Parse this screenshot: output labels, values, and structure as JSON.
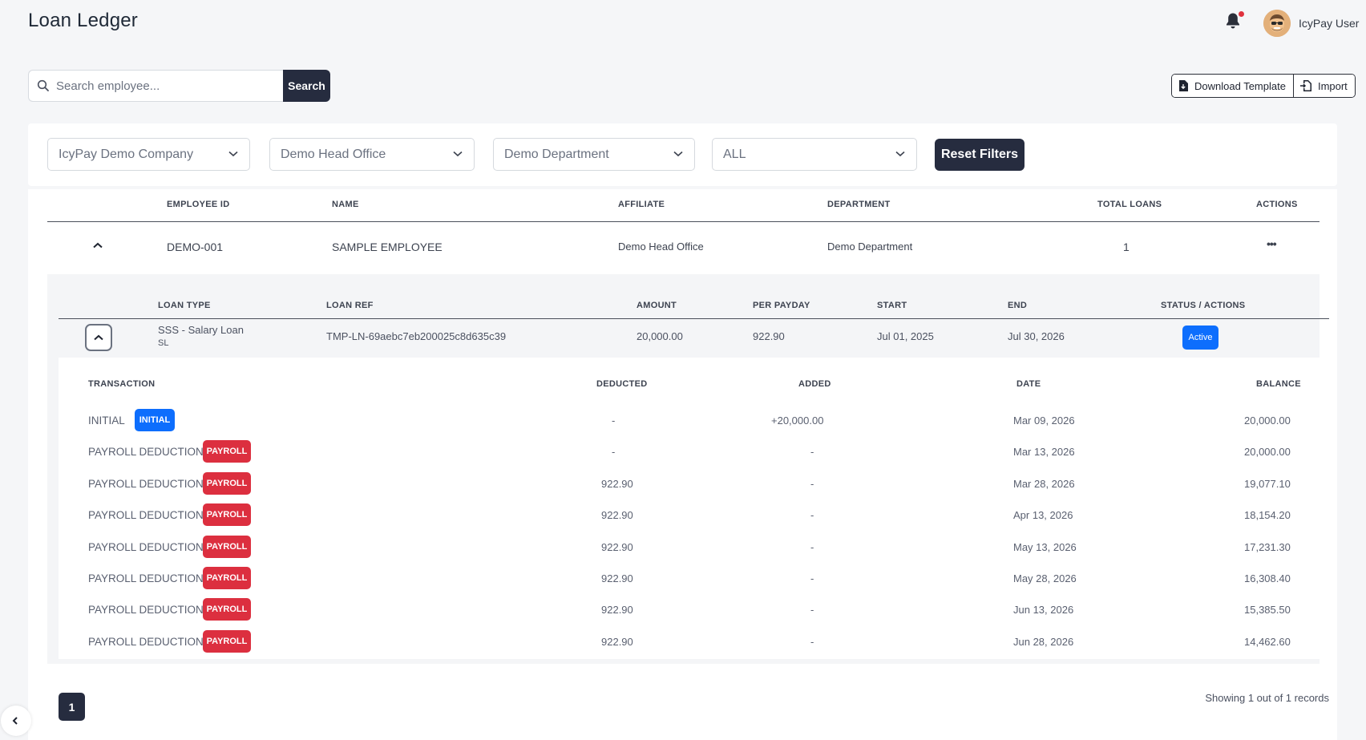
{
  "header": {
    "title": "Loan Ledger",
    "user_name": "IcyPay User"
  },
  "search": {
    "placeholder": "Search employee...",
    "value": "",
    "button_label": "Search"
  },
  "actions": {
    "download_template": "Download Template",
    "import": "Import"
  },
  "filters": {
    "company": "IcyPay Demo Company",
    "affiliate": "Demo Head Office",
    "department": "Demo Department",
    "status": "ALL",
    "reset_label": "Reset Filters"
  },
  "employee_table": {
    "headers": [
      "EMPLOYEE ID",
      "NAME",
      "AFFILIATE",
      "DEPARTMENT",
      "TOTAL LOANS",
      "ACTIONS"
    ],
    "rows": [
      {
        "employee_id": "DEMO-001",
        "name": "SAMPLE EMPLOYEE",
        "affiliate": "Demo Head Office",
        "department": "Demo Department",
        "total_loans": "1",
        "actions": "•••"
      }
    ]
  },
  "loan_table": {
    "headers": [
      "LOAN TYPE",
      "LOAN REF",
      "AMOUNT",
      "PER PAYDAY",
      "START",
      "END",
      "STATUS / ACTIONS"
    ],
    "rows": [
      {
        "loan_type": "SSS - Salary Loan",
        "loan_code": "SL",
        "loan_ref": "TMP-LN-69aebc7eb200025c8d635c39",
        "amount": "20,000.00",
        "per_payday": "922.90",
        "start": "Jul 01, 2025",
        "end": "Jul 30, 2026",
        "status": "Active"
      }
    ]
  },
  "transactions": {
    "headers": [
      "TRANSACTION",
      "DEDUCTED",
      "ADDED",
      "DATE",
      "BALANCE"
    ],
    "rows": [
      {
        "transaction": "INITIAL",
        "badge": "INITIAL",
        "deducted": "-",
        "added": "+20,000.00",
        "date": "Mar 09, 2026",
        "balance": "20,000.00"
      },
      {
        "transaction": "PAYROLL DEDUCTION",
        "badge": "PAYROLL",
        "deducted": "-",
        "added": "-",
        "date": "Mar 13, 2026",
        "balance": "20,000.00"
      },
      {
        "transaction": "PAYROLL DEDUCTION",
        "badge": "PAYROLL",
        "deducted": "922.90",
        "added": "-",
        "date": "Mar 28, 2026",
        "balance": "19,077.10"
      },
      {
        "transaction": "PAYROLL DEDUCTION",
        "badge": "PAYROLL",
        "deducted": "922.90",
        "added": "-",
        "date": "Apr 13, 2026",
        "balance": "18,154.20"
      },
      {
        "transaction": "PAYROLL DEDUCTION",
        "badge": "PAYROLL",
        "deducted": "922.90",
        "added": "-",
        "date": "May 13, 2026",
        "balance": "17,231.30"
      },
      {
        "transaction": "PAYROLL DEDUCTION",
        "badge": "PAYROLL",
        "deducted": "922.90",
        "added": "-",
        "date": "May 28, 2026",
        "balance": "16,308.40"
      },
      {
        "transaction": "PAYROLL DEDUCTION",
        "badge": "PAYROLL",
        "deducted": "922.90",
        "added": "-",
        "date": "Jun 13, 2026",
        "balance": "15,385.50"
      },
      {
        "transaction": "PAYROLL DEDUCTION",
        "badge": "PAYROLL",
        "deducted": "922.90",
        "added": "-",
        "date": "Jun 28, 2026",
        "balance": "14,462.60"
      }
    ]
  },
  "pagination": {
    "current_page": "1",
    "records_text": "Showing 1 out of 1 records"
  },
  "icons": {
    "bell": "bell-icon",
    "search": "search-icon",
    "download": "file-download-icon",
    "import": "file-import-icon",
    "chevron_down": "chevron-down-icon",
    "chevron_up": "chevron-up-icon",
    "chevron_left": "chevron-left-icon",
    "more": "more-horizontal-icon"
  },
  "colors": {
    "primary_dark": "#262c3f",
    "badge_blue": "#0d6efd",
    "badge_red": "#dc2f3f",
    "notification_dot": "#e0323e"
  }
}
